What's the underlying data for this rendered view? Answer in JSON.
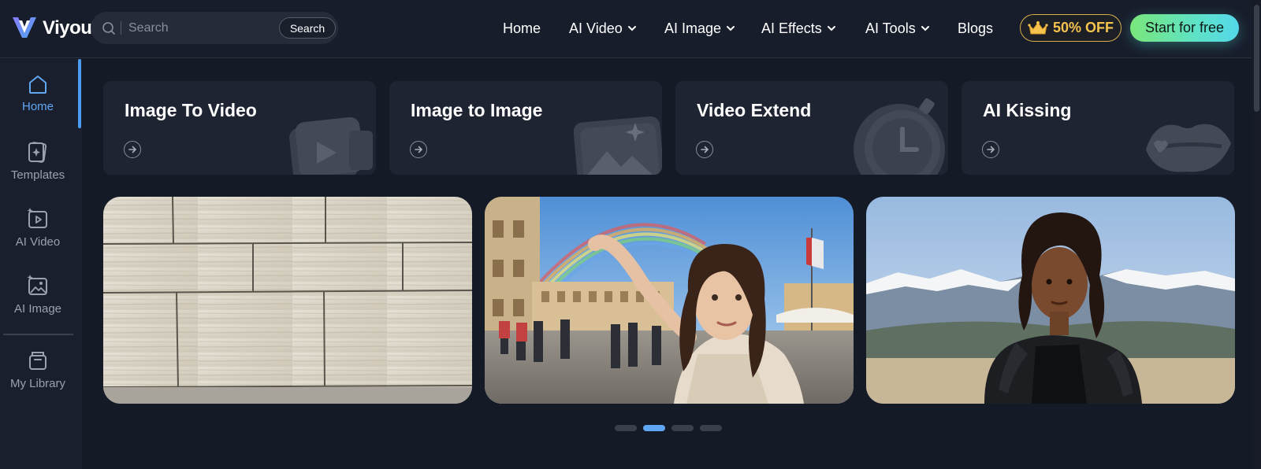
{
  "header": {
    "logo_text": "Viyou",
    "search": {
      "placeholder": "Search",
      "button_label": "Search"
    },
    "nav": [
      {
        "label": "Home",
        "dropdown": false
      },
      {
        "label": "AI Video",
        "dropdown": true
      },
      {
        "label": "AI Image",
        "dropdown": true
      },
      {
        "label": "AI Effects",
        "dropdown": true
      },
      {
        "label": "AI Tools",
        "dropdown": true
      },
      {
        "label": "Blogs",
        "dropdown": false
      }
    ],
    "offer_label": "50% OFF",
    "start_label": "Start for free"
  },
  "sidebar": {
    "items": [
      {
        "label": "Home",
        "icon": "home-icon",
        "active": true
      },
      {
        "label": "Templates",
        "icon": "templates-icon",
        "active": false
      },
      {
        "label": "AI Video",
        "icon": "ai-video-icon",
        "active": false
      },
      {
        "label": "AI Image",
        "icon": "ai-image-icon",
        "active": false
      },
      {
        "label": "My Library",
        "icon": "library-icon",
        "active": false
      }
    ]
  },
  "cards": [
    {
      "title": "Image To Video",
      "icon": "video-play-icon"
    },
    {
      "title": "Image to Image",
      "icon": "image-sparkle-icon"
    },
    {
      "title": "Video Extend",
      "icon": "stopwatch-icon"
    },
    {
      "title": "AI Kissing",
      "icon": "lips-icon"
    }
  ],
  "carousel": {
    "slides": [
      "stone-wall-slide",
      "rainbow-selfie-slide",
      "mountain-portrait-slide"
    ],
    "dots": 4,
    "active_dot": 2
  },
  "colors": {
    "background": "#151a27",
    "accent": "#5fa6f3",
    "offer": "#f5c34e",
    "start_gradient": [
      "#7ae67a",
      "#54d8ea"
    ]
  }
}
